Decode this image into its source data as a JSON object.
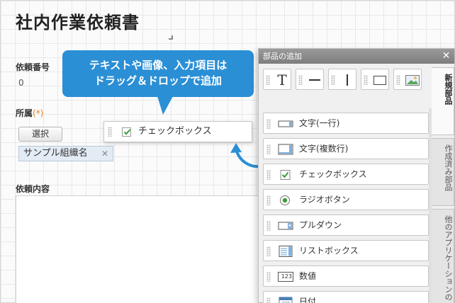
{
  "form": {
    "title": "社内作業依頼書",
    "request_no_label": "依頼番号",
    "request_no_value": "0",
    "dept_label": "所属",
    "required_mark": "(*)",
    "select_button": "選択",
    "org_tag": "サンプル組織名",
    "org_tag_remove": "✕",
    "content_label": "依頼内容"
  },
  "dragging_field": {
    "label": "チェックボックス"
  },
  "callout": {
    "line1": "テキストや画像、入力項目は",
    "line2": "ドラッグ＆ドロップで追加"
  },
  "panel": {
    "title": "部品の追加",
    "close": "✕",
    "tabs": [
      {
        "label": "新規部品",
        "active": true
      },
      {
        "label": "作成済み部品",
        "active": false
      },
      {
        "label": "他のアプリケーションの",
        "active": false
      }
    ],
    "toolbar": [
      {
        "icon": "text-icon"
      },
      {
        "icon": "horizontal-line-icon"
      },
      {
        "icon": "vertical-line-icon"
      },
      {
        "icon": "box-icon"
      },
      {
        "icon": "image-icon"
      }
    ],
    "items": [
      {
        "label": "文字(一行)",
        "icon": "single-line-text-icon"
      },
      {
        "label": "文字(複数行)",
        "icon": "multi-line-text-icon"
      },
      {
        "label": "チェックボックス",
        "icon": "checkbox-icon"
      },
      {
        "label": "ラジオボタン",
        "icon": "radio-button-icon"
      },
      {
        "label": "プルダウン",
        "icon": "dropdown-icon"
      },
      {
        "label": "リストボックス",
        "icon": "listbox-icon"
      },
      {
        "label": "数値",
        "icon": "number-icon",
        "icon_text": "123"
      },
      {
        "label": "日付",
        "icon": "calendar-icon"
      }
    ]
  },
  "colors": {
    "accent": "#2b8fd6",
    "required": "#e67e22",
    "panel_header": "#8a8a8a"
  }
}
